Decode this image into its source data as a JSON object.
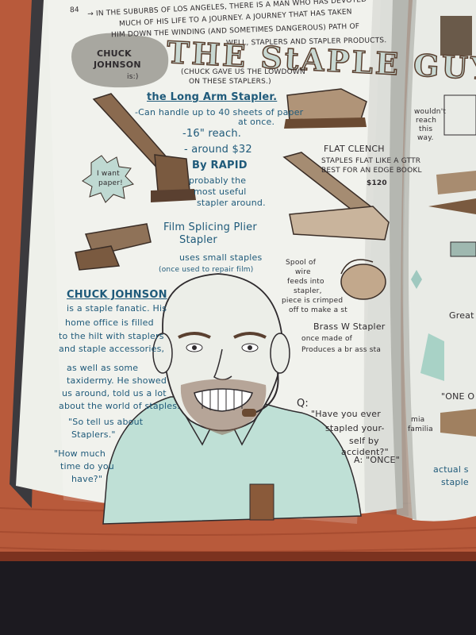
{
  "page": {
    "page_number": "84",
    "intro_lines": [
      "→ IN THE SUBURBS OF LOS ANGELES, THERE IS A MAN WHO HAS DEVOTED",
      "MUCH OF HIS LIFE TO A JOURNEY. A JOURNEY THAT HAS TAKEN",
      "HIM DOWN THE WINDING (AND SOMETIMES DANGEROUS) PATH OF",
      "WELL, STAPLERS AND STAPLER PRODUCTS."
    ],
    "name_tag": [
      "CHUCK",
      "JOHNSON",
      "is:)"
    ],
    "title": "THE StAPLE GUY.",
    "subtitle": [
      "(CHUCK GAVE US THE LOWDOWN",
      "ON THESE STAPLERS.)"
    ]
  },
  "stapler_1": {
    "name": "the Long Arm Stapler.",
    "lines": [
      "-Can handle up to 40 sheets of paper",
      "at once.",
      "-16\" reach.",
      "- around $32",
      "By RAPID"
    ],
    "note_lines": [
      "probably the",
      "most useful",
      "stapler around."
    ],
    "speech": [
      "I want",
      "paper!"
    ]
  },
  "stapler_2": {
    "name": "FLAT CLENCH",
    "lines": [
      "STAPLES FLAT LIKE A GTTR",
      "BEST FOR AN EDGE BOOKL",
      "$120"
    ]
  },
  "stapler_3": {
    "name_lines": [
      "Film Splicing Plier",
      "Stapler"
    ],
    "lines": [
      "uses small staples",
      "(once used to repair film)"
    ]
  },
  "spool_note": [
    "Spool of",
    "wire",
    "feeds into",
    "stapler,",
    "piece is crimped",
    "off to make a st"
  ],
  "brass": {
    "name": "Brass W Stapler",
    "lines": [
      "once made of",
      "Produces a br  ass sta"
    ]
  },
  "story": {
    "heading": "CHUCK JOHNSON",
    "lines": [
      "is a staple fanatic. His",
      "home office is filled",
      "to the hilt with staplers",
      "and staple accessories,",
      "",
      "as well as some",
      "taxidermy. He showed",
      "us around, told us a lot",
      "about the world of staples.",
      "\"So tell us about",
      "Staplers.\""
    ],
    "question": [
      "\"How much",
      "time do you",
      "have?\""
    ]
  },
  "qa": {
    "q_label": "Q:",
    "question": [
      "\"Have you ever",
      "stapled your-",
      "self by",
      "accident?\""
    ],
    "a_label": "A: \"ONCE\""
  },
  "right_page": {
    "note": [
      "wouldn't",
      "reach",
      "this",
      "way."
    ],
    "label_great": "Great",
    "label_one": "\"ONE O",
    "label_mia": [
      "mia",
      "familia"
    ],
    "label_actual": [
      "actual s",
      "staple"
    ]
  },
  "colors": {
    "table": "#b4573a",
    "page": "#edefe9",
    "ink": "#2f2b2e",
    "mint": "#b9d9d0",
    "brown": "#7a5a40"
  }
}
